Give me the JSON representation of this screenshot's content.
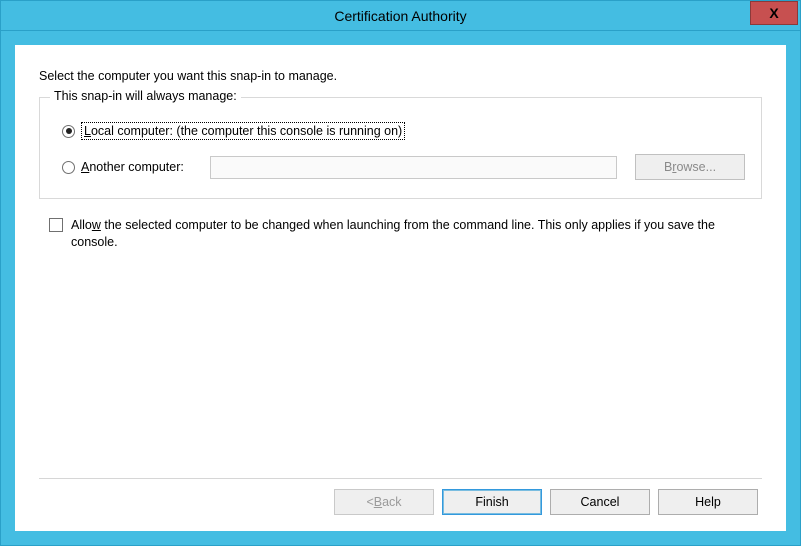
{
  "window": {
    "title": "Certification Authority",
    "close_glyph": "X"
  },
  "body": {
    "instruction": "Select the computer you want this snap-in to manage.",
    "group_legend": "This snap-in will always manage:",
    "radio_local_prefix": "L",
    "radio_local_rest": "ocal computer:  (the computer this console is running on)",
    "radio_another_prefix": "A",
    "radio_another_rest": "nother computer:",
    "another_value": "",
    "browse_prefix": "B",
    "browse_u": "r",
    "browse_rest": "owse...",
    "allow_change_prefix": "Allo",
    "allow_change_u": "w",
    "allow_change_rest": " the selected computer to be changed when launching from the command line. This only applies if you save the console.",
    "radio_selected": "local",
    "allow_change_checked": false
  },
  "footer": {
    "back_prefix": "< ",
    "back_u": "B",
    "back_rest": "ack",
    "finish_label": "Finish",
    "cancel_label": "Cancel",
    "help_label": "Help"
  }
}
